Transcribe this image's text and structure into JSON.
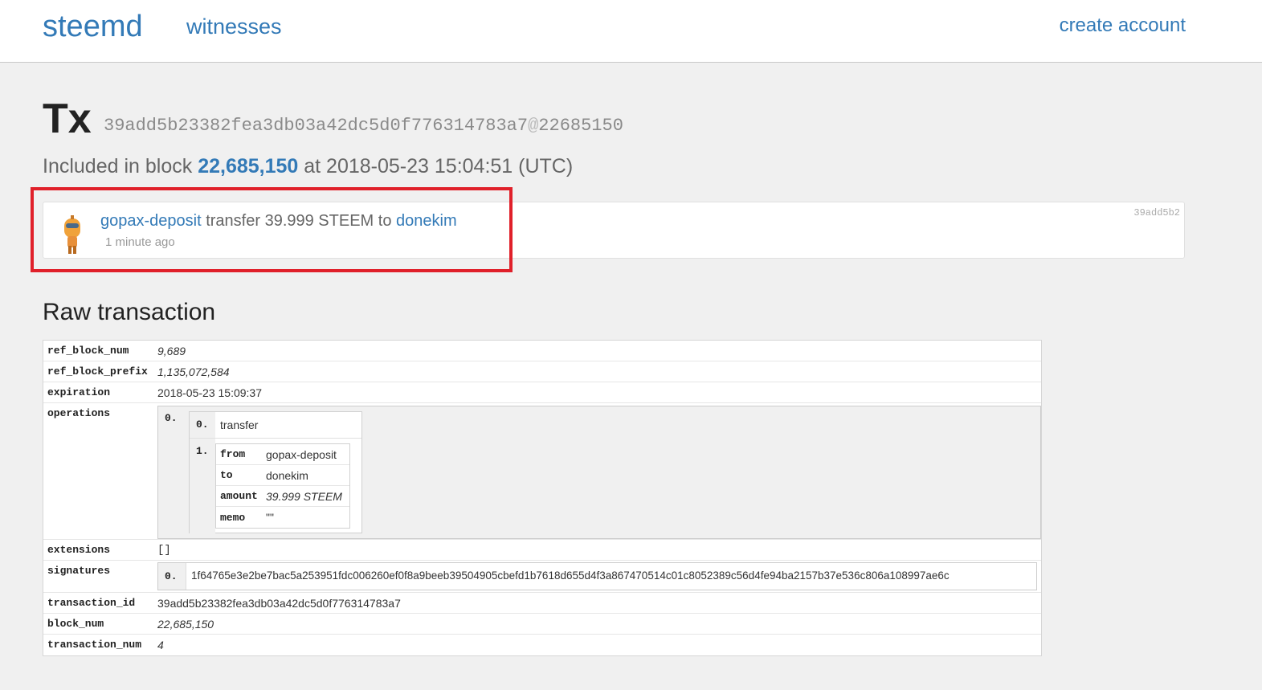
{
  "nav": {
    "brand": "steemd",
    "witnesses": "witnesses",
    "create_account": "create account"
  },
  "header": {
    "title": "Tx",
    "hash": "39add5b23382fea3db03a42dc5d0f776314783a7",
    "at_symbol": "@",
    "block_ref": "22685150",
    "included_prefix": "Included in block",
    "included_block": "22,685,150",
    "included_suffix": "at 2018-05-23 15:04:51 (UTC)"
  },
  "op_card": {
    "from": "gopax-deposit",
    "action": "transfer 39.999 STEEM to",
    "to": "donekim",
    "time": "1 minute ago",
    "short_hash": "39add5b2"
  },
  "raw": {
    "title": "Raw transaction",
    "rows": {
      "ref_block_num": {
        "key": "ref_block_num",
        "value": "9,689"
      },
      "ref_block_prefix": {
        "key": "ref_block_prefix",
        "value": "1,135,072,584"
      },
      "expiration": {
        "key": "expiration",
        "value": "2018-05-23 15:09:37"
      },
      "operations": {
        "key": "operations"
      },
      "extensions": {
        "key": "extensions",
        "value": "[]"
      },
      "signatures": {
        "key": "signatures"
      },
      "transaction_id": {
        "key": "transaction_id",
        "value": "39add5b23382fea3db03a42dc5d0f776314783a7"
      },
      "block_num": {
        "key": "block_num",
        "value": "22,685,150"
      },
      "transaction_num": {
        "key": "transaction_num",
        "value": "4"
      }
    },
    "operations": {
      "outer_index": "0.",
      "type_index": "0.",
      "type": "transfer",
      "params_index": "1.",
      "params": {
        "from": {
          "key": "from",
          "value": "gopax-deposit"
        },
        "to": {
          "key": "to",
          "value": "donekim"
        },
        "amount": {
          "key": "amount",
          "value": "39.999 STEEM"
        },
        "memo": {
          "key": "memo",
          "value": "\"\""
        }
      }
    },
    "signatures": {
      "index": "0.",
      "value": "1f64765e3e2be7bac5a253951fdc006260ef0f8a9beeb39504905cbefd1b7618d655d4f3a867470514c01c8052389c56d4fe94ba2157b37e536c806a108997ae6c"
    }
  }
}
